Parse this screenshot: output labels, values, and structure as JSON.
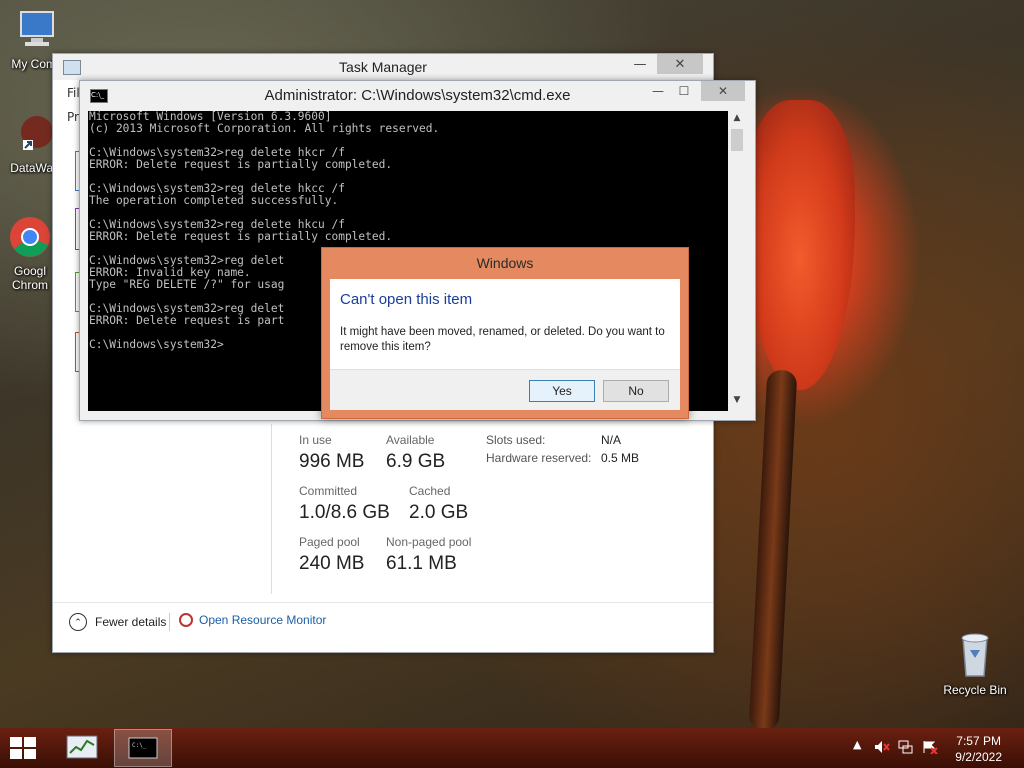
{
  "desktop": {
    "icons": [
      {
        "label": "My Comp",
        "icon": "computer-icon"
      },
      {
        "label": "DataWag",
        "icon": "app-shortcut-icon"
      },
      {
        "label": "Googl Chrom",
        "icon": "chrome-icon"
      },
      {
        "label": "Recycle Bin",
        "icon": "recycle-bin-icon"
      }
    ]
  },
  "task_manager": {
    "title": "Task Manager",
    "menu_partial": "Fil",
    "tab_partial": "Pr",
    "memory": {
      "in_use_label": "In use",
      "in_use_value": "996 MB",
      "available_label": "Available",
      "available_value": "6.9 GB",
      "committed_label": "Committed",
      "committed_value": "1.0/8.6 GB",
      "cached_label": "Cached",
      "cached_value": "2.0 GB",
      "paged_label": "Paged pool",
      "paged_value": "240 MB",
      "nonpaged_label": "Non-paged pool",
      "nonpaged_value": "61.1 MB",
      "slots_label": "Slots used:",
      "slots_value": "N/A",
      "hw_label": "Hardware reserved:",
      "hw_value": "0.5 MB"
    },
    "fewer_details": "Fewer details",
    "open_resource_monitor": "Open Resource Monitor"
  },
  "cmd": {
    "title": "Administrator: C:\\Windows\\system32\\cmd.exe",
    "icon_text": "C:\\_",
    "lines": [
      "Microsoft Windows [Version 6.3.9600]",
      "(c) 2013 Microsoft Corporation. All rights reserved.",
      "",
      "C:\\Windows\\system32>reg delete hkcr /f",
      "ERROR: Delete request is partially completed.",
      "",
      "C:\\Windows\\system32>reg delete hkcc /f",
      "The operation completed successfully.",
      "",
      "C:\\Windows\\system32>reg delete hkcu /f",
      "ERROR: Delete request is partially completed.",
      "",
      "C:\\Windows\\system32>reg delet",
      "ERROR: Invalid key name.",
      "Type \"REG DELETE /?\" for usag",
      "",
      "C:\\Windows\\system32>reg delet",
      "ERROR: Delete request is part",
      "",
      "C:\\Windows\\system32>"
    ]
  },
  "dialog": {
    "title": "Windows",
    "heading": "Can't open this item",
    "message": "It might have been moved, renamed, or deleted. Do you want to remove this item?",
    "yes": "Yes",
    "no": "No"
  },
  "taskbar": {
    "time": "7:57 PM",
    "date": "9/2/2022",
    "tray_icons": [
      "show-hidden-icons-arrow",
      "speaker-muted-icon",
      "network-icon",
      "action-center-icon"
    ]
  },
  "colors": {
    "dialog_frame": "#e58a60",
    "taskbar": "#4a1408",
    "link": "#1a5fa8",
    "dialog_heading": "#1a3e9a"
  }
}
